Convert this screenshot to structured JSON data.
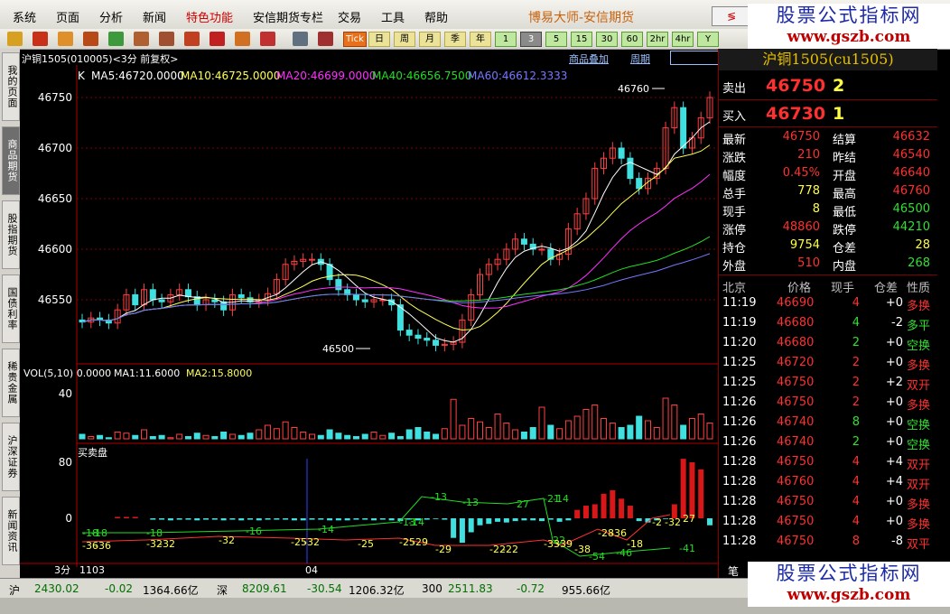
{
  "menu": {
    "items": [
      "系统",
      "页面",
      "分析",
      "新闻",
      "特色功能",
      "安信期货专栏",
      "交易",
      "工具",
      "帮助"
    ],
    "brand": "博易大师-安信期货",
    "stock_button": "≶"
  },
  "toolbar": {
    "periods": [
      "日",
      "周",
      "月",
      "季",
      "年",
      "1",
      "3",
      "5",
      "15",
      "30",
      "60",
      "2hr",
      "4hr",
      "Y"
    ],
    "selected_period": "3"
  },
  "left_tabs": [
    "我的页面",
    "商品期货",
    "股指期货",
    "国债利率",
    "稀贵金属",
    "沪深证券",
    "新闻资讯"
  ],
  "chart": {
    "symbol_label": "沪铜1505(010005)<3分 前复权>",
    "overlay_link": "商品叠加",
    "period_link": "周期",
    "ma_legend": {
      "k": "K",
      "ma5": "MA5:46720.0000",
      "ma10": "MA10:46725.0000",
      "ma20": "MA20:46699.0000",
      "ma40": "MA40:46656.7500",
      "ma60": "MA60:46612.3333"
    },
    "price_axis": [
      "46750",
      "46700",
      "46650",
      "46600",
      "46550"
    ],
    "annotation_high": "46760",
    "annotation_low": "46500",
    "volume_legend": {
      "vol": "VOL(5,10) 0.0000",
      "ma1": "MA1:11.6000",
      "ma2": "MA2:15.8000"
    },
    "volume_axis": [
      "40"
    ],
    "bs_title": "买卖盘",
    "bs_axis": [
      "80",
      "0"
    ],
    "bs_labels_green": [
      "-18",
      "-18",
      "-18",
      "-16",
      "-14",
      "-14",
      "-13",
      "-13",
      "-13",
      "27",
      "-21",
      "-14",
      "22",
      "-54",
      "-46",
      "-41"
    ],
    "bs_labels_yellow": [
      "-36",
      "-36",
      "-32",
      "-32",
      "-32",
      "-32",
      "-25",
      "-25",
      "-25",
      "-29",
      "-29",
      "-22",
      "-22",
      "-39",
      "-33",
      "-38",
      "-28",
      "-36",
      "-18",
      "-32",
      "-2",
      "27"
    ],
    "x_axis": [
      "3分",
      "1103",
      "04"
    ],
    "colors": {
      "ma5": "#ffffff",
      "ma10": "#ffff55",
      "ma20": "#ff30ff",
      "ma40": "#22dd22",
      "ma60": "#7777ff",
      "up": "#ff4040",
      "down": "#40e0e0"
    }
  },
  "quote": {
    "title": "沪铜1505(cu1505)",
    "sell_label": "卖出",
    "sell_price": "46750",
    "sell_vol": "2",
    "buy_label": "买入",
    "buy_price": "46730",
    "buy_vol": "1",
    "rows": [
      {
        "l1": "最新",
        "v1": "46750",
        "l2": "结算",
        "v2": "46632"
      },
      {
        "l1": "涨跌",
        "v1": "210",
        "l2": "昨结",
        "v2": "46540"
      },
      {
        "l1": "幅度",
        "v1": "0.45%",
        "l2": "开盘",
        "v2": "46640"
      },
      {
        "l1": "总手",
        "v1": "778",
        "l2": "最高",
        "v2": "46760"
      },
      {
        "l1": "现手",
        "v1": "8",
        "l2": "最低",
        "v2": "46500"
      },
      {
        "l1": "涨停",
        "v1": "48860",
        "l2": "跌停",
        "v2": "44210"
      },
      {
        "l1": "持仓",
        "v1": "9754",
        "l2": "仓差",
        "v2": "28"
      },
      {
        "l1": "外盘",
        "v1": "510",
        "l2": "内盘",
        "v2": "268"
      }
    ],
    "ticks_header": [
      "北京",
      "价格",
      "现手",
      "仓差",
      "性质"
    ],
    "ticks": [
      [
        "11:19",
        "46690",
        "4",
        "+0",
        "多换"
      ],
      [
        "11:19",
        "46680",
        "4",
        "-2",
        "多平"
      ],
      [
        "11:20",
        "46680",
        "2",
        "+0",
        "空换"
      ],
      [
        "11:25",
        "46720",
        "2",
        "+0",
        "多换"
      ],
      [
        "11:25",
        "46750",
        "2",
        "+2",
        "双开"
      ],
      [
        "11:26",
        "46750",
        "2",
        "+0",
        "多换"
      ],
      [
        "11:26",
        "46740",
        "8",
        "+0",
        "空换"
      ],
      [
        "11:26",
        "46740",
        "2",
        "+0",
        "空换"
      ],
      [
        "11:28",
        "46750",
        "4",
        "+4",
        "双开"
      ],
      [
        "11:28",
        "46760",
        "4",
        "+4",
        "双开"
      ],
      [
        "11:28",
        "46750",
        "4",
        "+0",
        "多换"
      ],
      [
        "11:28",
        "46750",
        "4",
        "+0",
        "多换"
      ],
      [
        "11:28",
        "46750",
        "8",
        "-8",
        "双平"
      ]
    ],
    "footer_label": "笔"
  },
  "status": {
    "sh_label": "沪",
    "sh_index": "2430.02",
    "sh_change": "-0.02",
    "sh_amount": "1364.66亿",
    "sz_label": "深",
    "sz_index": "8209.61",
    "sz_change": "-30.54",
    "sz_amount": "1206.32亿",
    "hs_label": "300",
    "hs_index": "2511.83",
    "hs_change": "-0.72",
    "hs_amount": "955.66亿"
  },
  "watermark": {
    "line1": "股票公式指标网",
    "line2": "www.gszb.com"
  }
}
